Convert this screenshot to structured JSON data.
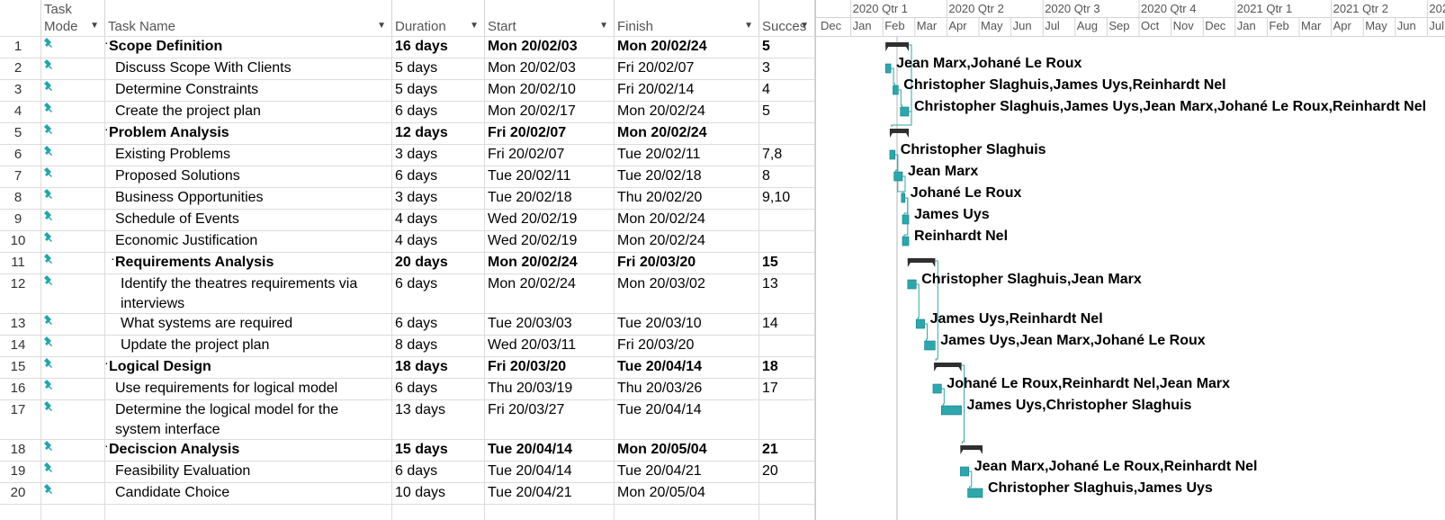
{
  "header": {
    "task_mode_1": "Task",
    "task_mode_2": "Mode",
    "task_name": "Task Name",
    "duration": "Duration",
    "start": "Start",
    "finish": "Finish",
    "successors": "Succes"
  },
  "timeline": {
    "quarters": [
      "2020 Qtr 1",
      "2020 Qtr 2",
      "2020 Qtr 3",
      "2020 Qtr 4",
      "2021 Qtr 1",
      "2021 Qtr 2",
      "202"
    ],
    "months": [
      "Dec",
      "Jan",
      "Feb",
      "Mar",
      "Apr",
      "May",
      "Jun",
      "Jul",
      "Aug",
      "Sep",
      "Oct",
      "Nov",
      "Dec",
      "Jan",
      "Feb",
      "Mar",
      "Apr",
      "May",
      "Jun",
      "Jul"
    ]
  },
  "colors": {
    "bar": "#2ea6ad",
    "bar_dark": "#0f7d85",
    "summary": "#2f2f2f",
    "pin": "#21a5b0",
    "grid": "#dcdcdc",
    "today_line": "#b7b7b7"
  },
  "tasks": [
    {
      "id": "1",
      "name": "Scope Definition",
      "duration": "16 days",
      "start": "Mon 20/02/03",
      "finish": "Mon 20/02/24",
      "successors": "5",
      "summary": true,
      "indent": 0,
      "resources": ""
    },
    {
      "id": "2",
      "name": "Discuss Scope With Clients",
      "duration": "5 days",
      "start": "Mon 20/02/03",
      "finish": "Fri 20/02/07",
      "successors": "3",
      "summary": false,
      "indent": 1,
      "resources": "Jean Marx,Johané Le Roux"
    },
    {
      "id": "3",
      "name": "Determine Constraints",
      "duration": "5 days",
      "start": "Mon 20/02/10",
      "finish": "Fri 20/02/14",
      "successors": "4",
      "summary": false,
      "indent": 1,
      "resources": "Christopher Slaghuis,James Uys,Reinhardt Nel"
    },
    {
      "id": "4",
      "name": "Create the project plan",
      "duration": "6 days",
      "start": "Mon 20/02/17",
      "finish": "Mon 20/02/24",
      "successors": "5",
      "summary": false,
      "indent": 1,
      "resources": "Christopher Slaghuis,James Uys,Jean Marx,Johané Le Roux,Reinhardt Nel"
    },
    {
      "id": "5",
      "name": "Problem Analysis",
      "duration": "12 days",
      "start": "Fri 20/02/07",
      "finish": "Mon 20/02/24",
      "successors": "",
      "summary": true,
      "indent": 0,
      "resources": ""
    },
    {
      "id": "6",
      "name": "Existing Problems",
      "duration": "3 days",
      "start": "Fri 20/02/07",
      "finish": "Tue 20/02/11",
      "successors": "7,8",
      "summary": false,
      "indent": 1,
      "resources": "Christopher Slaghuis"
    },
    {
      "id": "7",
      "name": "Proposed Solutions",
      "duration": "6 days",
      "start": "Tue 20/02/11",
      "finish": "Tue 20/02/18",
      "successors": "8",
      "summary": false,
      "indent": 1,
      "resources": "Jean Marx"
    },
    {
      "id": "8",
      "name": "Business Opportunities",
      "duration": "3 days",
      "start": "Tue 20/02/18",
      "finish": "Thu 20/02/20",
      "successors": "9,10",
      "summary": false,
      "indent": 1,
      "resources": "Johané Le Roux"
    },
    {
      "id": "9",
      "name": "Schedule of Events",
      "duration": "4 days",
      "start": "Wed 20/02/19",
      "finish": "Mon 20/02/24",
      "successors": "",
      "summary": false,
      "indent": 1,
      "resources": "James Uys"
    },
    {
      "id": "10",
      "name": "Economic Justification",
      "duration": "4 days",
      "start": "Wed 20/02/19",
      "finish": "Mon 20/02/24",
      "successors": "",
      "summary": false,
      "indent": 1,
      "resources": "Reinhardt Nel"
    },
    {
      "id": "11",
      "name": "Requirements Analysis",
      "duration": "20 days",
      "start": "Mon 20/02/24",
      "finish": "Fri 20/03/20",
      "successors": "15",
      "summary": true,
      "indent": 1,
      "resources": ""
    },
    {
      "id": "12",
      "name": "Identify the theatres requirements via interviews",
      "duration": "6 days",
      "start": "Mon 20/02/24",
      "finish": "Mon 20/03/02",
      "successors": "13",
      "summary": false,
      "indent": 2,
      "resources": "Christopher Slaghuis,Jean Marx"
    },
    {
      "id": "13",
      "name": "What systems are required",
      "duration": "6 days",
      "start": "Tue 20/03/03",
      "finish": "Tue 20/03/10",
      "successors": "14",
      "summary": false,
      "indent": 2,
      "resources": "James Uys,Reinhardt Nel"
    },
    {
      "id": "14",
      "name": "Update the project plan",
      "duration": "8 days",
      "start": "Wed 20/03/11",
      "finish": "Fri 20/03/20",
      "successors": "",
      "summary": false,
      "indent": 2,
      "resources": "James Uys,Jean Marx,Johané Le Roux"
    },
    {
      "id": "15",
      "name": "Logical Design",
      "duration": "18 days",
      "start": "Fri 20/03/20",
      "finish": "Tue 20/04/14",
      "successors": "18",
      "summary": true,
      "indent": 0,
      "resources": ""
    },
    {
      "id": "16",
      "name": "Use requirements for logical model",
      "duration": "6 days",
      "start": "Thu 20/03/19",
      "finish": "Thu 20/03/26",
      "successors": "17",
      "summary": false,
      "indent": 1,
      "resources": "Johané Le Roux,Reinhardt Nel,Jean Marx"
    },
    {
      "id": "17",
      "name": "Determine the logical model for the system interface",
      "duration": "13 days",
      "start": "Fri 20/03/27",
      "finish": "Tue 20/04/14",
      "successors": "",
      "summary": false,
      "indent": 1,
      "resources": "James Uys,Christopher Slaghuis"
    },
    {
      "id": "18",
      "name": "Deciscion Analysis",
      "duration": "15 days",
      "start": "Tue 20/04/14",
      "finish": "Mon 20/05/04",
      "successors": "21",
      "summary": true,
      "indent": 0,
      "resources": ""
    },
    {
      "id": "19",
      "name": "Feasibility Evaluation",
      "duration": "6 days",
      "start": "Tue 20/04/14",
      "finish": "Tue 20/04/21",
      "successors": "20",
      "summary": false,
      "indent": 1,
      "resources": "Jean Marx,Johané Le Roux,Reinhardt Nel"
    },
    {
      "id": "20",
      "name": "Candidate Choice",
      "duration": "10 days",
      "start": "Tue 20/04/21",
      "finish": "Mon 20/05/04",
      "successors": "",
      "summary": false,
      "indent": 1,
      "resources": "Christopher Slaghuis,James Uys"
    }
  ]
}
